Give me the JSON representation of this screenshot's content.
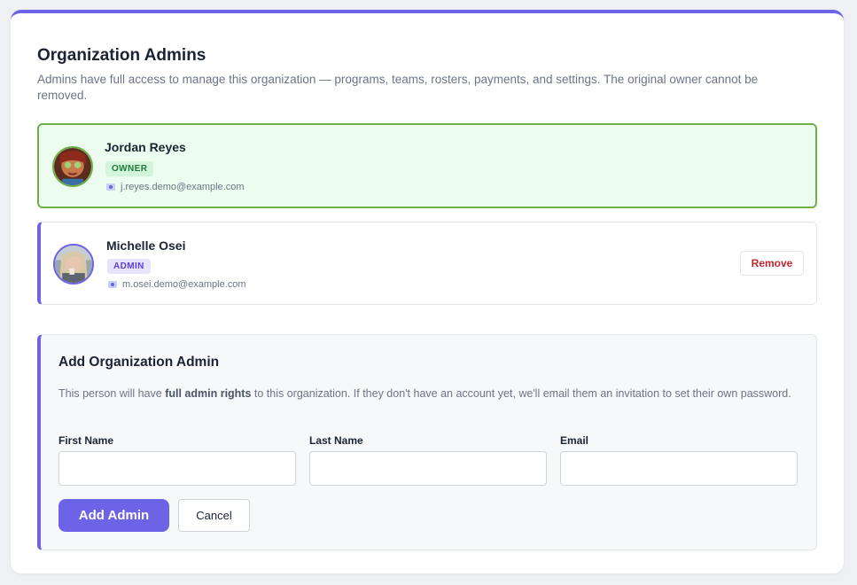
{
  "section": {
    "title": "Organization Admins",
    "description": "Admins have full access to manage this organization — programs, teams, rosters, payments, and settings. The original owner cannot be removed."
  },
  "admins": [
    {
      "name": "Jordan Reyes",
      "role": "OWNER",
      "email": "j.reyes.demo@example.com",
      "icon": "mail-icon"
    },
    {
      "name": "Michelle Osei",
      "role": "ADMIN",
      "email": "m.osei.demo@example.com",
      "icon": "mail-icon",
      "remove_label": "Remove"
    }
  ],
  "add_admin": {
    "title": "Add Organization Admin",
    "desc_prefix": "This person will have ",
    "desc_bold": "full admin rights",
    "desc_suffix": " to this organization. If they don't have an account yet, we'll email them an invitation to set their own password.",
    "fields": {
      "first_name": {
        "label": "First Name",
        "value": ""
      },
      "last_name": {
        "label": "Last Name",
        "value": ""
      },
      "email": {
        "label": "Email",
        "value": ""
      }
    },
    "submit_label": "Add Admin",
    "cancel_label": "Cancel"
  },
  "colors": {
    "accent": "#6d63e6",
    "owner_green": "#6fb049",
    "danger": "#c2262e"
  }
}
